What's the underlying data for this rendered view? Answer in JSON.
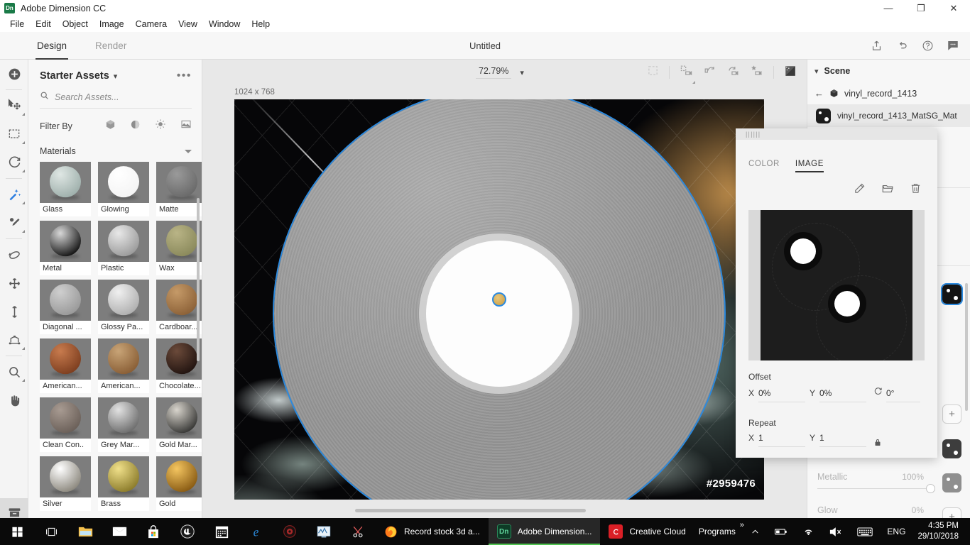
{
  "window": {
    "app_name": "Adobe Dimension CC",
    "logo_text": "Dn",
    "minimize": "—",
    "maximize": "❐",
    "close": "✕"
  },
  "menubar": {
    "items": [
      "File",
      "Edit",
      "Object",
      "Image",
      "Camera",
      "View",
      "Window",
      "Help"
    ]
  },
  "tabbar": {
    "tabs": [
      {
        "label": "Design",
        "active": true
      },
      {
        "label": "Render",
        "active": false
      }
    ],
    "document_title": "Untitled",
    "actions": [
      {
        "name": "share-icon",
        "glyph": "⇧"
      },
      {
        "name": "undo-icon",
        "glyph": "↶"
      },
      {
        "name": "help-icon",
        "glyph": "?"
      },
      {
        "name": "feedback-icon",
        "glyph": "●●●"
      }
    ]
  },
  "toolrail": {
    "items": [
      {
        "name": "add-object-tool",
        "glyph": "⊕"
      },
      {
        "name": "select-move-tool",
        "glyph": "select"
      },
      {
        "name": "marquee-tool",
        "glyph": "marquee"
      },
      {
        "name": "rotate-tool",
        "glyph": "rotate"
      },
      {
        "name": "magic-wand-tool",
        "glyph": "wand"
      },
      {
        "name": "eyedropper-tool",
        "glyph": "dropper"
      },
      {
        "name": "orbit-tool",
        "glyph": "orbit"
      },
      {
        "name": "pan-object-tool",
        "glyph": "move"
      },
      {
        "name": "dolly-tool",
        "glyph": "dolly"
      },
      {
        "name": "horizon-tool",
        "glyph": "horizon"
      },
      {
        "name": "zoom-tool",
        "glyph": "zoom"
      },
      {
        "name": "hand-tool",
        "glyph": "hand"
      },
      {
        "name": "content-library-tool",
        "glyph": "library"
      }
    ]
  },
  "assets": {
    "title": "Starter Assets",
    "menu_glyph": "•••",
    "search_placeholder": "Search Assets...",
    "search_value": "",
    "filter_label": "Filter By",
    "filter_icons": [
      "model-filter-icon",
      "material-filter-icon",
      "light-filter-icon",
      "image-filter-icon"
    ],
    "section_title": "Materials",
    "materials": [
      {
        "label": "Glass",
        "c1": "#dfe7e4",
        "c2": "#9fb0ac"
      },
      {
        "label": "Glowing",
        "c1": "#ffffff",
        "c2": "#f4f4f4"
      },
      {
        "label": "Matte",
        "c1": "#9a9a9a",
        "c2": "#6a6a6a"
      },
      {
        "label": "Metal",
        "c1": "#d8d8d8",
        "c2": "#171717"
      },
      {
        "label": "Plastic",
        "c1": "#e8e8e8",
        "c2": "#9c9c9c"
      },
      {
        "label": "Wax",
        "c1": "#b9b486",
        "c2": "#8b8a5c"
      },
      {
        "label": "Diagonal ...",
        "c1": "#cfcfcf",
        "c2": "#9a9a9a"
      },
      {
        "label": "Glossy Pa...",
        "c1": "#f0f0f0",
        "c2": "#b0b0b0"
      },
      {
        "label": "Cardboar...",
        "c1": "#c59a68",
        "c2": "#8d6238"
      },
      {
        "label": "American...",
        "c1": "#c87b4e",
        "c2": "#7e3f20"
      },
      {
        "label": "American...",
        "c1": "#c8a477",
        "c2": "#8a5f36"
      },
      {
        "label": "Chocolate...",
        "c1": "#6b4a3a",
        "c2": "#231511"
      },
      {
        "label": "Clean Con..",
        "c1": "#a89b92",
        "c2": "#6b6059"
      },
      {
        "label": "Grey Mar...",
        "c1": "#e2e2e2",
        "c2": "#6f6f6f"
      },
      {
        "label": "Gold Mar...",
        "c1": "#d8d4cc",
        "c2": "#3a3a38"
      },
      {
        "label": "Silver",
        "c1": "#ffffff",
        "c2": "#8e8a80"
      },
      {
        "label": "Brass",
        "c1": "#f0e08a",
        "c2": "#8d7d2c"
      },
      {
        "label": "Gold",
        "c1": "#f4c560",
        "c2": "#8a5c14"
      }
    ]
  },
  "canvas": {
    "zoom_level": "72.79%",
    "zoom_caret": "⌄",
    "dimensions": "1024 x 768",
    "watermark": "#2959476",
    "tools": [
      {
        "name": "selection-bounds-icon"
      },
      {
        "name": "camera-frame-icon"
      },
      {
        "name": "camera-orbit-left-icon"
      },
      {
        "name": "camera-orbit-right-icon"
      },
      {
        "name": "camera-bookmark-icon"
      },
      {
        "name": "render-preview-icon"
      }
    ]
  },
  "right_panel": {
    "scene_title": "Scene",
    "scene_caret": "⌄",
    "back_glyph": "←",
    "object_name": "vinyl_record_1413",
    "material_name": "vinyl_record_1413_MatSG_Mat",
    "properties": [
      {
        "label": "Metallic",
        "value": "100%"
      },
      {
        "label": "Glow",
        "value": "0%"
      }
    ],
    "add_button": "+"
  },
  "popup": {
    "grip": "||||||",
    "tabs": [
      {
        "label": "COLOR",
        "active": false
      },
      {
        "label": "IMAGE",
        "active": true
      }
    ],
    "actions": [
      {
        "name": "edit-pencil-icon",
        "glyph": "✎"
      },
      {
        "name": "open-folder-icon",
        "glyph": "📁"
      },
      {
        "name": "delete-trash-icon",
        "glyph": "🗑"
      }
    ],
    "offset": {
      "label": "Offset",
      "x_axis": "X",
      "x_value": "0%",
      "y_axis": "Y",
      "y_value": "0%",
      "rotation_icon": "rotation-icon",
      "rotation_value": "0°"
    },
    "repeat": {
      "label": "Repeat",
      "x_axis": "X",
      "x_value": "1",
      "y_axis": "Y",
      "y_value": "1",
      "lock_icon": "lock-icon"
    }
  },
  "taskbar": {
    "start": "start-button",
    "taskview": "task-view-button",
    "pinned": [
      {
        "name": "file-explorer-icon",
        "glyph": "📁",
        "color": "#f5c14e"
      },
      {
        "name": "mail-icon",
        "glyph": "✉",
        "color": "#ffffff"
      },
      {
        "name": "microsoft-store-icon",
        "glyph": "🛍",
        "color": "#ffffff"
      },
      {
        "name": "unreal-engine-icon",
        "glyph": "Ⓤ",
        "color": "#dddddd"
      },
      {
        "name": "calendar-icon",
        "glyph": "📅",
        "color": "#ffffff"
      },
      {
        "name": "edge-icon",
        "glyph": "e",
        "color": "#2b88d8"
      },
      {
        "name": "poison-app-icon",
        "glyph": "◉",
        "color": "#b03030"
      },
      {
        "name": "system-monitor-icon",
        "glyph": "🖵",
        "color": "#9fc3e0"
      },
      {
        "name": "snipping-tool-icon",
        "glyph": "✂",
        "color": "#e05a5a"
      }
    ],
    "apps": [
      {
        "name": "firefox-window",
        "label": "Record stock 3d a...",
        "icon": "firefox-icon",
        "active": false,
        "running": true,
        "color": "#ff7a1a"
      },
      {
        "name": "dimension-window",
        "label": "Adobe Dimension...",
        "icon": "dimension-icon",
        "active": true,
        "running": true,
        "color": "#1a7a47"
      },
      {
        "name": "creative-cloud-window",
        "label": "Creative Cloud",
        "icon": "creative-cloud-icon",
        "active": false,
        "running": true,
        "color": "#da1f26"
      }
    ],
    "programs_label": "Programs",
    "programs_overflow": "»",
    "tray": [
      {
        "name": "show-hidden-icons",
        "glyph": "∧"
      },
      {
        "name": "battery-icon",
        "glyph": "🔋"
      },
      {
        "name": "wifi-icon",
        "glyph": "📶"
      },
      {
        "name": "volume-muted-icon",
        "glyph": "🔇"
      },
      {
        "name": "keyboard-icon",
        "glyph": "⌨"
      },
      {
        "name": "language-indicator",
        "glyph": "ENG"
      }
    ],
    "clock_time": "4:35 PM",
    "clock_date": "29/10/2018"
  },
  "colors": {
    "accent_blue": "#2b8ae0",
    "taskbar_active_underline": "#51c451",
    "panel_bg": "#f7f7f7",
    "canvas_bg": "#e8e8e8"
  }
}
